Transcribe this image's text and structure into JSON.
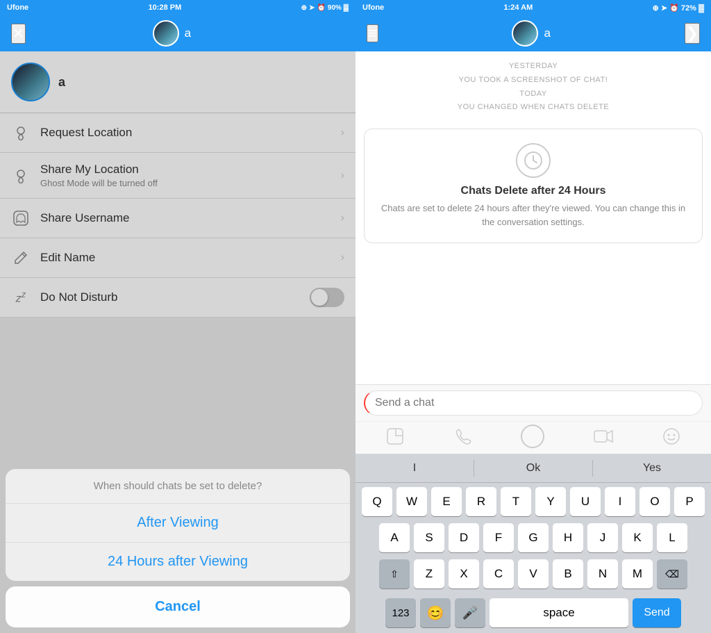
{
  "left": {
    "statusBar": {
      "carrier": "Ufone",
      "time": "10:28 PM",
      "icons": "⊕ ➤ ⏰ 90%"
    },
    "nav": {
      "closeIcon": "✕",
      "username": "a"
    },
    "profile": {
      "name": "a"
    },
    "menuItems": [
      {
        "icon": "📍",
        "title": "Request Location",
        "subtitle": "",
        "type": "arrow"
      },
      {
        "icon": "📍",
        "title": "Share My Location",
        "subtitle": "Ghost Mode will be turned off",
        "type": "arrow"
      },
      {
        "icon": "👻",
        "title": "Share Username",
        "subtitle": "",
        "type": "arrow"
      },
      {
        "icon": "✏️",
        "title": "Edit Name",
        "subtitle": "",
        "type": "arrow"
      },
      {
        "icon": "💤",
        "title": "Do Not Disturb",
        "subtitle": "",
        "type": "toggle"
      }
    ],
    "actionSheet": {
      "title": "When should chats be set to delete?",
      "options": [
        "After Viewing",
        "24 Hours after Viewing"
      ],
      "cancel": "Cancel"
    }
  },
  "right": {
    "statusBar": {
      "carrier": "Ufone",
      "time": "1:24 AM",
      "icons": "⊕ ➤ ⏰ 72%"
    },
    "nav": {
      "menuIcon": "≡",
      "username": "a",
      "nextIcon": "❯"
    },
    "chat": {
      "notifications": [
        "YESTERDAY",
        "YOU TOOK A SCREENSHOT OF CHAT!",
        "TODAY",
        "YOU CHANGED WHEN CHATS DELETE"
      ],
      "card": {
        "title": "Chats Delete after 24 Hours",
        "description": "Chats are set to delete 24 hours after they're viewed. You can change this in the conversation settings."
      },
      "inputPlaceholder": "Send a chat"
    },
    "keyboard": {
      "suggestions": [
        "I",
        "Ok",
        "Yes"
      ],
      "rows": [
        [
          "Q",
          "W",
          "E",
          "R",
          "T",
          "Y",
          "U",
          "I",
          "O",
          "P"
        ],
        [
          "A",
          "S",
          "D",
          "F",
          "G",
          "H",
          "J",
          "K",
          "L"
        ],
        [
          "Z",
          "X",
          "C",
          "V",
          "B",
          "N",
          "M"
        ],
        [
          "123",
          "space",
          "Send"
        ]
      ]
    }
  }
}
